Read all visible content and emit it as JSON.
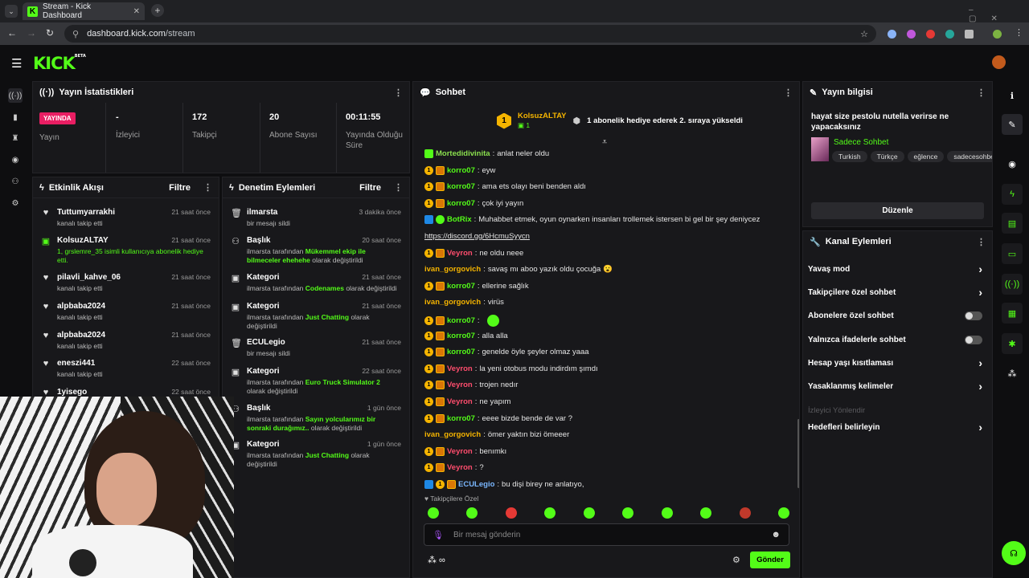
{
  "browser": {
    "tab_title": "Stream - Kick Dashboard",
    "url_domain": "dashboard.kick.com",
    "url_path": "/stream"
  },
  "brand": {
    "logo": "KICK",
    "beta": "BETA",
    "accent": "#53fc18"
  },
  "stats": {
    "title": "Yayın İstatistikleri",
    "items": [
      {
        "value": "YAYINDA",
        "label": "Yayın"
      },
      {
        "value": "-",
        "label": "İzleyici"
      },
      {
        "value": "172",
        "label": "Takipçi"
      },
      {
        "value": "20",
        "label": "Abone Sayısı"
      },
      {
        "value": "00:11:55",
        "label": "Yayında Olduğu Süre"
      }
    ]
  },
  "activity": {
    "title": "Etkinlik Akışı",
    "filter": "Filtre",
    "items": [
      {
        "icon": "heart-icon",
        "name": "Tuttumyarrakhi",
        "desc": "kanalı takip etti",
        "time": "21 saat önce"
      },
      {
        "icon": "gift-icon",
        "name": "KolsuzALTAY",
        "desc": "1, grslemre_35 isimli kullanıcıya abonelik hediye etti.",
        "time": "21 saat önce"
      },
      {
        "icon": "heart-icon",
        "name": "pilavli_kahve_06",
        "desc": "kanalı takip etti",
        "time": "21 saat önce"
      },
      {
        "icon": "heart-icon",
        "name": "alpbaba2024",
        "desc": "kanalı takip etti",
        "time": "21 saat önce"
      },
      {
        "icon": "heart-icon",
        "name": "alpbaba2024",
        "desc": "kanalı takip etti",
        "time": "21 saat önce"
      },
      {
        "icon": "heart-icon",
        "name": "eneszi441",
        "desc": "kanalı takip etti",
        "time": "22 saat önce"
      },
      {
        "icon": "heart-icon",
        "name": "1yisego",
        "desc": "",
        "time": "22 saat önce"
      }
    ]
  },
  "moderation": {
    "title": "Denetim Eylemleri",
    "filter": "Filtre",
    "items": [
      {
        "icon": "trash-icon",
        "name": "ilmarsta",
        "pre": "bir mesajı sildi",
        "hl": "",
        "post": "",
        "time": "3 dakika önce"
      },
      {
        "icon": "users-icon",
        "name": "Başlık",
        "pre": "ilmarsta tarafından ",
        "hl": "Mükemmel ekip ile bilmeceler ehehehe",
        "post": " olarak değiştirildi",
        "time": "20 saat önce"
      },
      {
        "icon": "category-icon",
        "name": "Kategori",
        "pre": "ilmarsta tarafından ",
        "hl": "Codenames",
        "post": " olarak değiştirildi",
        "time": "21 saat önce"
      },
      {
        "icon": "category-icon",
        "name": "Kategori",
        "pre": "ilmarsta tarafından ",
        "hl": "Just Chatting",
        "post": " olarak değiştirildi",
        "time": "21 saat önce"
      },
      {
        "icon": "trash-icon",
        "name": "ECULegio",
        "pre": "bir mesajı sildi",
        "hl": "",
        "post": "",
        "time": "21 saat önce"
      },
      {
        "icon": "category-icon",
        "name": "Kategori",
        "pre": "ilmarsta tarafından ",
        "hl": "Euro Truck Simulator 2",
        "post": " olarak değiştirildi",
        "time": "22 saat önce"
      },
      {
        "icon": "users-icon",
        "name": "Başlık",
        "pre": "ilmarsta tarafından ",
        "hl": "Sayın yolcularımız bir sonraki durağımız..",
        "post": " olarak değiştirildi",
        "time": "1 gün önce"
      },
      {
        "icon": "category-icon",
        "name": "Kategori",
        "pre": "ilmarsta tarafından ",
        "hl": "Just Chatting",
        "post": " olarak değiştirildi",
        "time": "1 gün önce"
      }
    ]
  },
  "chat": {
    "title": "Sohbet",
    "pinned_user": "KolsuzALTAY",
    "pinned_count": "1",
    "pinned_text": "1 abonelik hediye ederek 2. sıraya yükseldi",
    "messages": [
      {
        "user": "Mortedidivinita",
        "color": "#8be04e",
        "text": "anlat neler oldu",
        "badges": "gift"
      },
      {
        "user": "korro07",
        "color": "#53fc18",
        "text": "eyw",
        "badges": "sub"
      },
      {
        "user": "korro07",
        "color": "#53fc18",
        "text": "ama ets olayı beni benden aldı",
        "badges": "sub"
      },
      {
        "user": "korro07",
        "color": "#53fc18",
        "text": "çok iyi yayın",
        "badges": "sub"
      },
      {
        "user": "BotRix",
        "color": "#53fc18",
        "text": "Muhabbet etmek, oyun oynarken insanları trollemek istersen bi gel bir şey deniycez",
        "badges": "bot"
      },
      {
        "user": "",
        "color": "#e6e6e6",
        "text": "https://discord.gg/6HcmuSyycn",
        "badges": "none"
      },
      {
        "user": "Veyron",
        "color": "#ff4d6d",
        "text": "ne oldu neee",
        "badges": "sub"
      },
      {
        "user": "ivan_gorgovich",
        "color": "#f5b400",
        "text": "savaş mı aboo yazık oldu çocuğa 😮",
        "badges": "none"
      },
      {
        "user": "korro07",
        "color": "#53fc18",
        "text": "ellerine sağlık",
        "badges": "sub"
      },
      {
        "user": "ivan_gorgovich",
        "color": "#f5b400",
        "text": "virüs",
        "badges": "none"
      },
      {
        "user": "korro07",
        "color": "#53fc18",
        "text": "",
        "badges": "sub"
      },
      {
        "user": "korro07",
        "color": "#53fc18",
        "text": "alla alla",
        "badges": "sub"
      },
      {
        "user": "korro07",
        "color": "#53fc18",
        "text": "genelde öyle şeyler olmaz yaaa",
        "badges": "sub"
      },
      {
        "user": "Veyron",
        "color": "#ff4d6d",
        "text": "la yeni otobus modu indirdım şımdı",
        "badges": "sub"
      },
      {
        "user": "Veyron",
        "color": "#ff4d6d",
        "text": "trojen nedır",
        "badges": "sub"
      },
      {
        "user": "Veyron",
        "color": "#ff4d6d",
        "text": "ne yapım",
        "badges": "sub"
      },
      {
        "user": "korro07",
        "color": "#53fc18",
        "text": "eeee bizde bende de var ?",
        "badges": "sub"
      },
      {
        "user": "ivan_gorgovich",
        "color": "#f5b400",
        "text": "ömer yaktın bizi ömeeer",
        "badges": "none"
      },
      {
        "user": "Veyron",
        "color": "#ff4d6d",
        "text": "benımkı",
        "badges": "sub"
      },
      {
        "user": "Veyron",
        "color": "#ff4d6d",
        "text": "?",
        "badges": "sub"
      },
      {
        "user": "ECULegio",
        "color": "#7ab7ff",
        "text": "bu dişi birey ne anlatıyo,",
        "badges": "mod"
      }
    ],
    "follower_only": "Takipçilere Özel",
    "input_placeholder": "Bir mesaj gönderin",
    "send": "Gönder"
  },
  "stream_info": {
    "title": "Yayın bilgisi",
    "stream_title": "hayat size pestolu nutella verirse ne yapacaksınız",
    "category": "Sadece Sohbet",
    "tags": [
      "Turkish",
      "Türkçe",
      "eğlence",
      "sadecesohbe"
    ],
    "edit": "Düzenle"
  },
  "channel_actions": {
    "title": "Kanal Eylemleri",
    "items": [
      {
        "label": "Yavaş mod",
        "type": "chevron"
      },
      {
        "label": "Takipçilere özel sohbet",
        "type": "chevron"
      },
      {
        "label": "Abonelere özel sohbet",
        "type": "toggle"
      },
      {
        "label": "Yalnızca ifadelerle sohbet",
        "type": "toggle"
      },
      {
        "label": "Hesap yaşı kısıtlaması",
        "type": "chevron"
      },
      {
        "label": "Yasaklanmış kelimeler",
        "type": "chevron"
      },
      {
        "label": "İzleyici Yönlendir",
        "type": "disabled"
      },
      {
        "label": "Hedefleri belirleyin",
        "type": "chevron"
      }
    ]
  }
}
